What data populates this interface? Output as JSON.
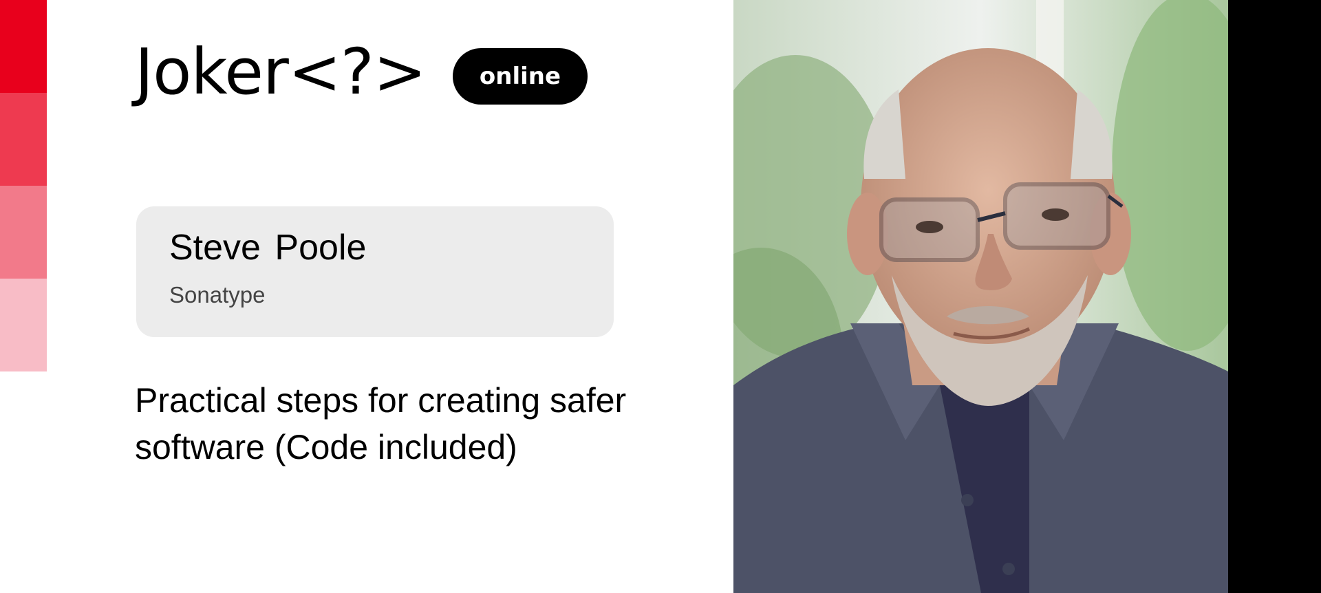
{
  "brand": {
    "logo_text": "Joker<?>",
    "badge": "online",
    "stripe_colors": [
      "#e8001c",
      "#ee3a50",
      "#f27a8a",
      "#f8bcc6"
    ]
  },
  "speaker": {
    "name": "Steve Poole",
    "company": "Sonatype",
    "photo_icon": "speaker-portrait"
  },
  "talk": {
    "title": "Practical steps for creating safer software (Code included)"
  }
}
